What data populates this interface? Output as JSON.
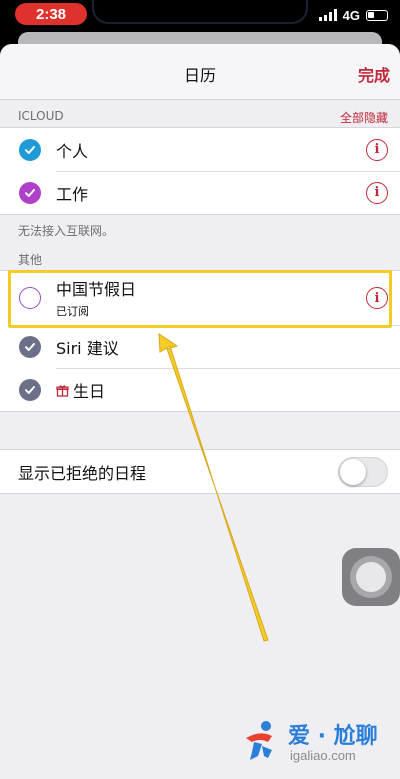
{
  "status_bar": {
    "time": "2:38",
    "network": "4G"
  },
  "nav": {
    "title": "日历",
    "done_label": "完成"
  },
  "icloud": {
    "header": "ICLOUD",
    "hide_all": "全部隐藏",
    "items": [
      {
        "label": "个人",
        "checked": true,
        "color": "#1e9bd7"
      },
      {
        "label": "工作",
        "checked": true,
        "color": "#b03fc9"
      }
    ],
    "footer": "无法接入互联网。"
  },
  "other": {
    "header": "其他",
    "items": [
      {
        "label": "中国节假日",
        "sub": "已订阅",
        "checked": false,
        "color": "#9a4fc0"
      },
      {
        "label": "Siri 建议",
        "checked": true,
        "color": "#6b7088"
      },
      {
        "label": "生日",
        "checked": true,
        "color": "#6b7088",
        "icon": "gift-icon"
      }
    ]
  },
  "settings": {
    "declined_label": "显示已拒绝的日程",
    "declined_on": false
  },
  "watermark": {
    "text": "爱 · 尬聊",
    "url": "igaliao.com"
  },
  "colors": {
    "accent": "#c0283a",
    "highlight": "#f3cc26",
    "time_pill": "#e0322c"
  }
}
